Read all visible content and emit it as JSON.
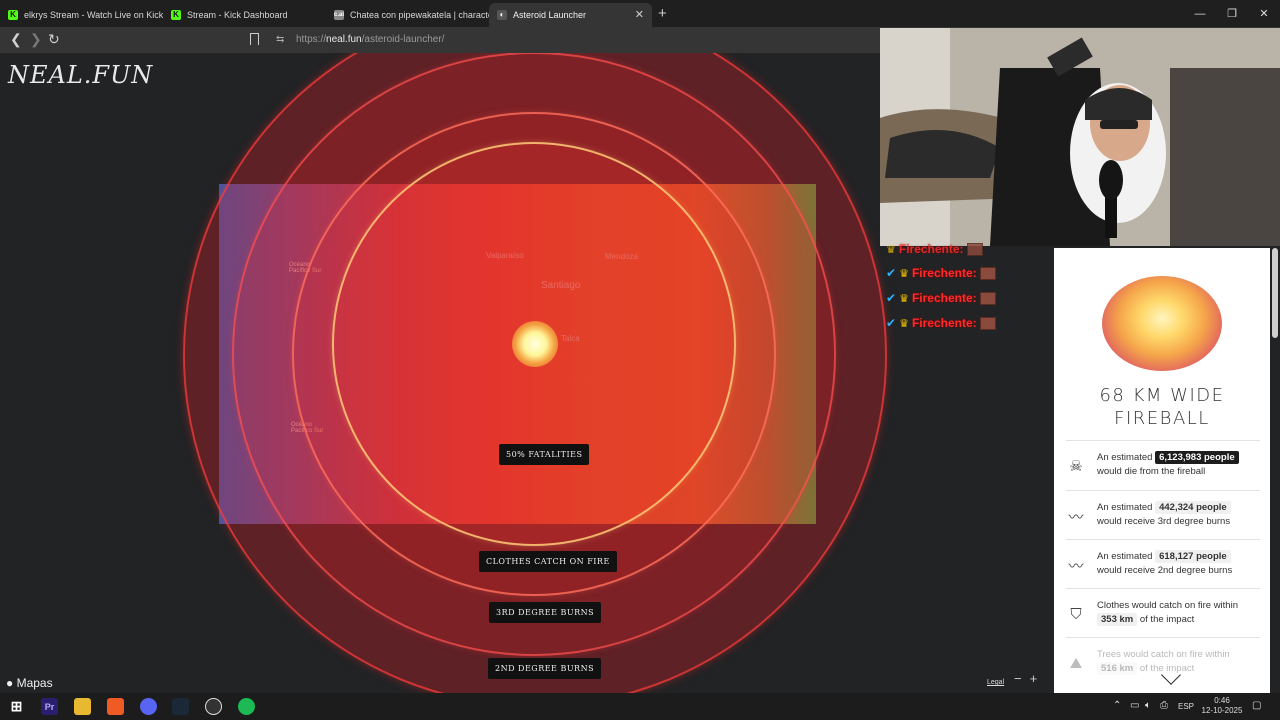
{
  "tabs": [
    {
      "title": "elkrys Stream - Watch Live on Kick",
      "icon": "kick-icon",
      "color": "#53fc18",
      "active": false
    },
    {
      "title": "Stream - Kick Dashboard",
      "icon": "kick-icon",
      "color": "#53fc18",
      "active": false
    },
    {
      "title": "Chatea con pipewakatela | character...",
      "icon": "character-ai-icon",
      "color": "#888888",
      "active": false
    },
    {
      "title": "Asteroid Launcher",
      "icon": "neal-fun-icon",
      "color": "#555555",
      "active": true
    }
  ],
  "tab_close_glyph": "✕",
  "new_tab_glyph": "+",
  "window_controls": [
    "—",
    "❐",
    "✕"
  ],
  "nav": {
    "back": "❮",
    "forward": "❯",
    "reload": "↻",
    "tune": "⇆"
  },
  "url": {
    "prefix": "https://",
    "domain": "neal.fun",
    "path": "/asteroid-launcher/"
  },
  "site": {
    "logo": "NEAL.FUN"
  },
  "map": {
    "labels": [
      "Valparaíso",
      "Santiago",
      "Mendoza",
      "Océano Pacífico Sur",
      "Océano Pacífico Sur",
      "Talca"
    ],
    "attribution": " Mapas",
    "legal": "Legal",
    "zoom_out": "−",
    "zoom_in": "+",
    "ring_labels": [
      "50% FATALITIES",
      "CLOTHES CATCH ON FIRE",
      "3RD DEGREE BURNS",
      "2ND DEGREE BURNS"
    ]
  },
  "chat": {
    "rows": [
      {
        "name": "Firechente:"
      },
      {
        "name": "Firechente:"
      },
      {
        "name": "Firechente:"
      },
      {
        "name": "Firechente:"
      }
    ]
  },
  "panel": {
    "title": "68 KM WIDE FIREBALL",
    "stats": [
      {
        "icon": "skull-icon",
        "glyph": "☠",
        "pre": "An estimated",
        "value": "6,123,983 people",
        "post": "would die from the fireball",
        "style": "dark"
      },
      {
        "icon": "burn-icon",
        "glyph": "〰",
        "pre": "An estimated",
        "value": "442,324 people",
        "post": "would receive 3rd degree burns",
        "style": "light"
      },
      {
        "icon": "burn-icon",
        "glyph": "〰",
        "pre": "An estimated",
        "value": "618,127 people",
        "post": "would receive 2nd degree burns",
        "style": "light"
      },
      {
        "icon": "shirt-icon",
        "glyph": "⛉",
        "pre": "Clothes would catch on fire within",
        "value": "353 km",
        "post": "of the impact",
        "style": "light"
      },
      {
        "icon": "tree-icon",
        "glyph": "⛰",
        "pre": "Trees would catch on fire within",
        "value": "516 km",
        "post": "of the impact",
        "style": "light"
      }
    ]
  },
  "taskbar": {
    "start": "⊞",
    "apps": [
      {
        "label": "Pr",
        "color": "#2a1f6e"
      },
      {
        "label": "",
        "color": "#e8b830"
      },
      {
        "label": "",
        "color": "#f05a24"
      },
      {
        "label": "",
        "color": "#5865f2"
      },
      {
        "label": "",
        "color": "#1b2838"
      },
      {
        "label": "",
        "color": "#333333"
      },
      {
        "label": "",
        "color": "#1db954"
      }
    ],
    "tray": {
      "chevron": "⌃",
      "lang": "ESP",
      "notify": "▢"
    },
    "time": "0:46",
    "date": "12-10-2025"
  }
}
